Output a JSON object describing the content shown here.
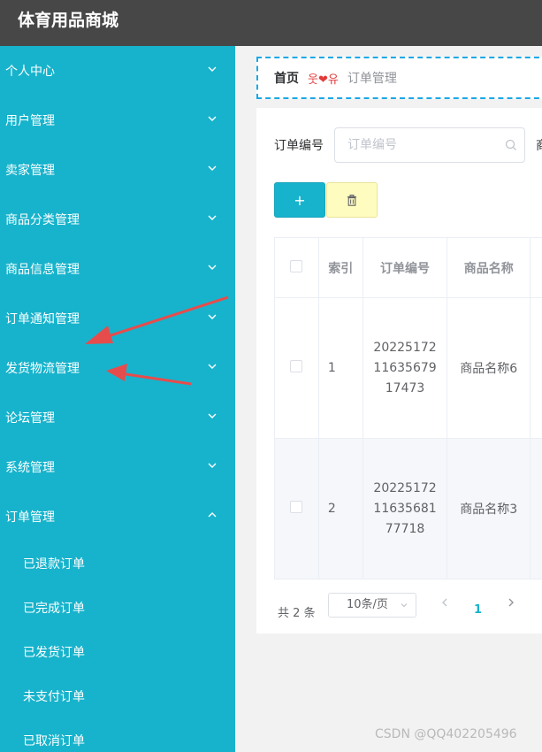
{
  "app": {
    "title": "体育用品商城"
  },
  "sidebar": {
    "items": [
      {
        "label": "个人中心"
      },
      {
        "label": "用户管理"
      },
      {
        "label": "卖家管理"
      },
      {
        "label": "商品分类管理"
      },
      {
        "label": "商品信息管理"
      },
      {
        "label": "订单通知管理"
      },
      {
        "label": "发货物流管理"
      },
      {
        "label": "论坛管理"
      },
      {
        "label": "系统管理"
      },
      {
        "label": "订单管理"
      }
    ],
    "subitems": [
      {
        "label": "已退款订单"
      },
      {
        "label": "已完成订单"
      },
      {
        "label": "已发货订单"
      },
      {
        "label": "未支付订单"
      },
      {
        "label": "已取消订单"
      }
    ]
  },
  "breadcrumb": {
    "home": "首页",
    "separator": "웃❤유",
    "current": "订单管理"
  },
  "search": {
    "label": "订单编号",
    "placeholder": "订单编号",
    "next_label_cut": "商"
  },
  "toolbar": {
    "add_label": "+"
  },
  "table": {
    "headers": [
      "索引",
      "订单编号",
      "商品名称"
    ],
    "rows": [
      {
        "index": "1",
        "order_no": "202251721163567917473",
        "product": "商品名称6"
      },
      {
        "index": "2",
        "order_no": "202251721163568177718",
        "product": "商品名称3"
      }
    ]
  },
  "pagination": {
    "total": "共 2 条",
    "page_size": "10条/页",
    "current_page": "1"
  },
  "watermark": "CSDN @QQ402205496",
  "colors": {
    "sidebar": "#17b3cc",
    "topbar": "#474747",
    "accent": "#17b3cc",
    "arrow": "#e74c4c"
  }
}
